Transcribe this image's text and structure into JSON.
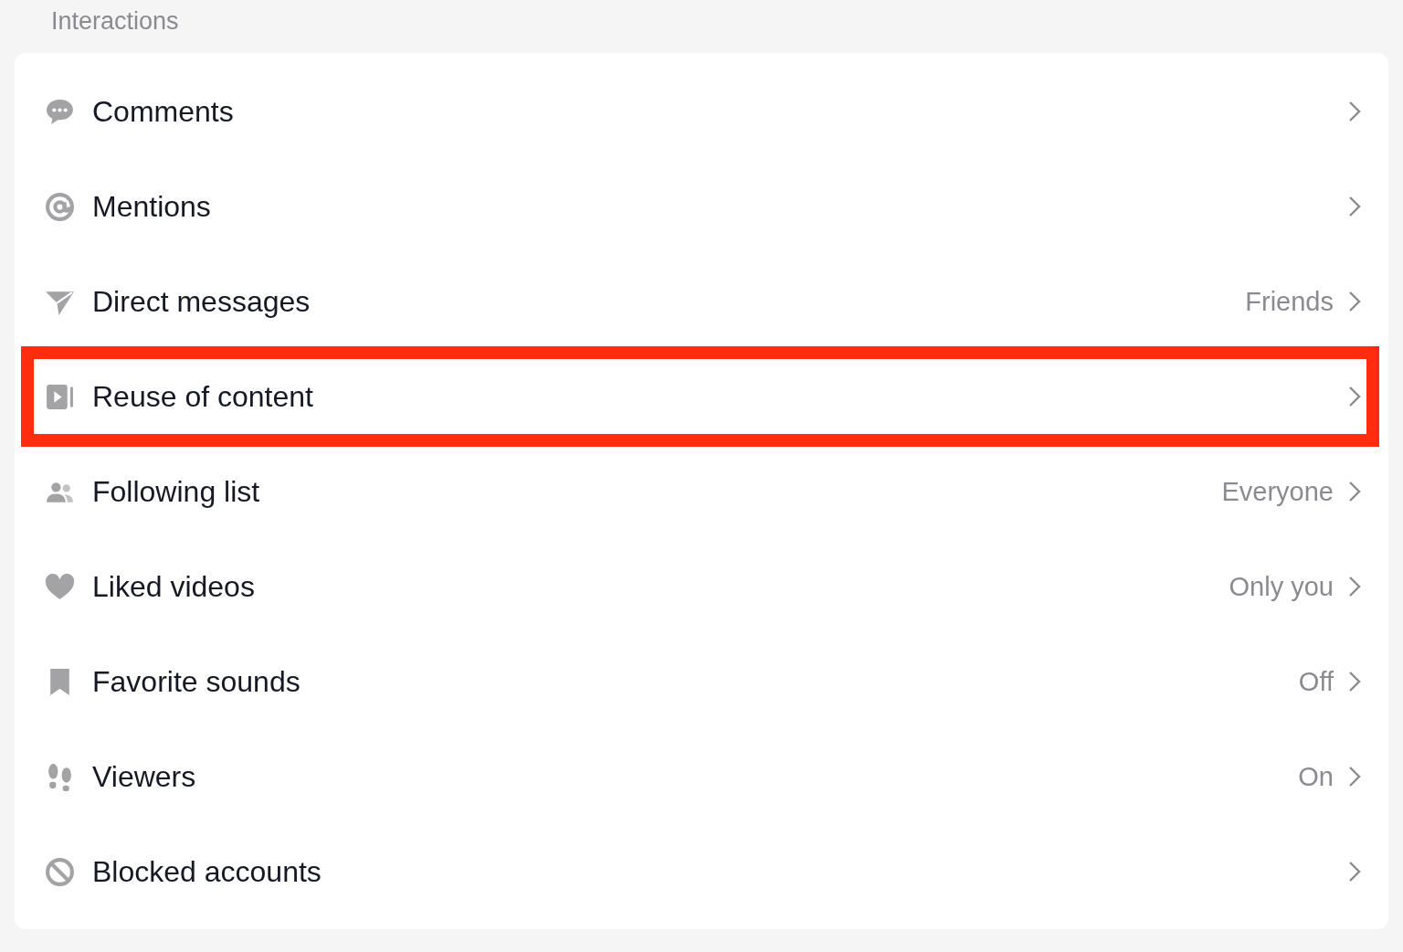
{
  "section_title": "Interactions",
  "items": [
    {
      "label": "Comments",
      "highlighted": false
    },
    {
      "label": "Mentions",
      "highlighted": false
    },
    {
      "label": "Direct messages",
      "value": "Friends",
      "highlighted": false
    },
    {
      "label": "Reuse of content",
      "highlighted": true
    },
    {
      "label": "Following list",
      "value": "Everyone",
      "highlighted": false
    },
    {
      "label": "Liked videos",
      "value": "Only you",
      "highlighted": false
    },
    {
      "label": "Favorite sounds",
      "value": "Off",
      "highlighted": false
    },
    {
      "label": "Viewers",
      "value": "On",
      "highlighted": false
    },
    {
      "label": "Blocked accounts",
      "highlighted": false
    }
  ]
}
